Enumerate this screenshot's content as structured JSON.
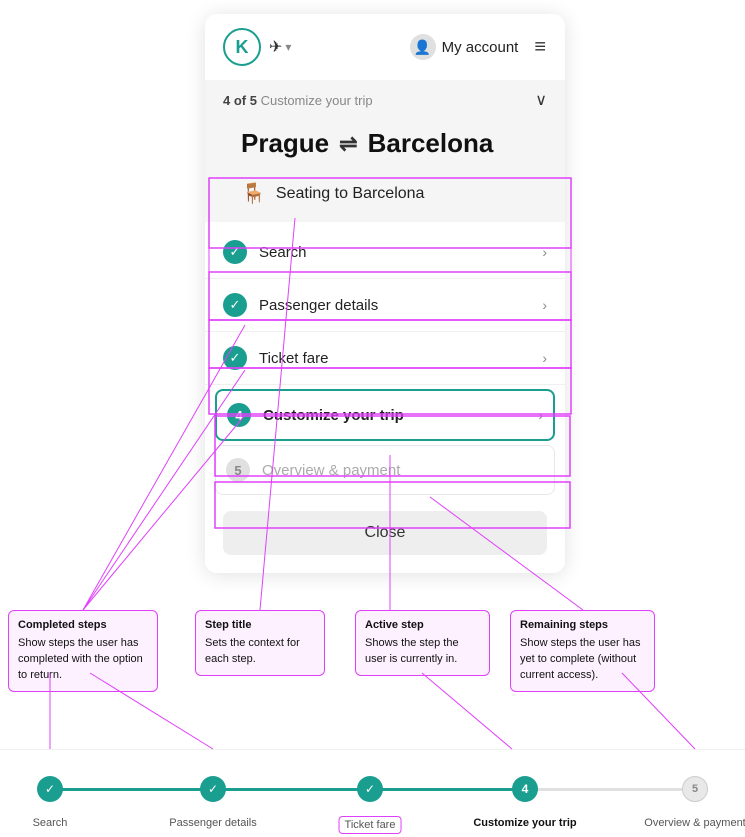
{
  "nav": {
    "logo_letter": "K",
    "flight_icon": "✈",
    "dropdown_arrow": "▾",
    "account_label": "My account",
    "hamburger": "≡"
  },
  "card": {
    "step_progress": "4 of 5",
    "step_progress_of": "of 5",
    "step_label": "Customize your trip",
    "chevron": "∨",
    "route_from": "Prague",
    "route_arrows": "⇌",
    "route_to": "Barcelona",
    "seating_icon": "🪑",
    "seating_label": "Seating to Barcelona"
  },
  "steps": [
    {
      "id": 1,
      "type": "check",
      "label": "Search"
    },
    {
      "id": 2,
      "type": "check",
      "label": "Passenger details"
    },
    {
      "id": 3,
      "type": "check",
      "label": "Ticket fare"
    },
    {
      "id": 4,
      "type": "active",
      "label": "Customize your trip"
    },
    {
      "id": 5,
      "type": "remaining",
      "label": "Overview & payment"
    }
  ],
  "close_button": "Close",
  "annotations": {
    "completed": {
      "title": "Completed steps",
      "desc": "Show steps the user has completed with the option to return."
    },
    "step_title": {
      "title": "Step title",
      "desc": "Sets the context for each step."
    },
    "active_step": {
      "title": "Active step",
      "desc": "Shows the step the user is currently in."
    },
    "remaining": {
      "title": "Remaining steps",
      "desc": "Show steps the user has yet to complete (without current access)."
    }
  },
  "bottom_steps": [
    {
      "label": "Search",
      "type": "check"
    },
    {
      "label": "Passenger details",
      "type": "check"
    },
    {
      "label": "Ticket fare",
      "type": "check",
      "outlined": true
    },
    {
      "label": "Customize your trip",
      "type": "active"
    },
    {
      "label": "Overview & payment",
      "type": "inactive"
    }
  ]
}
